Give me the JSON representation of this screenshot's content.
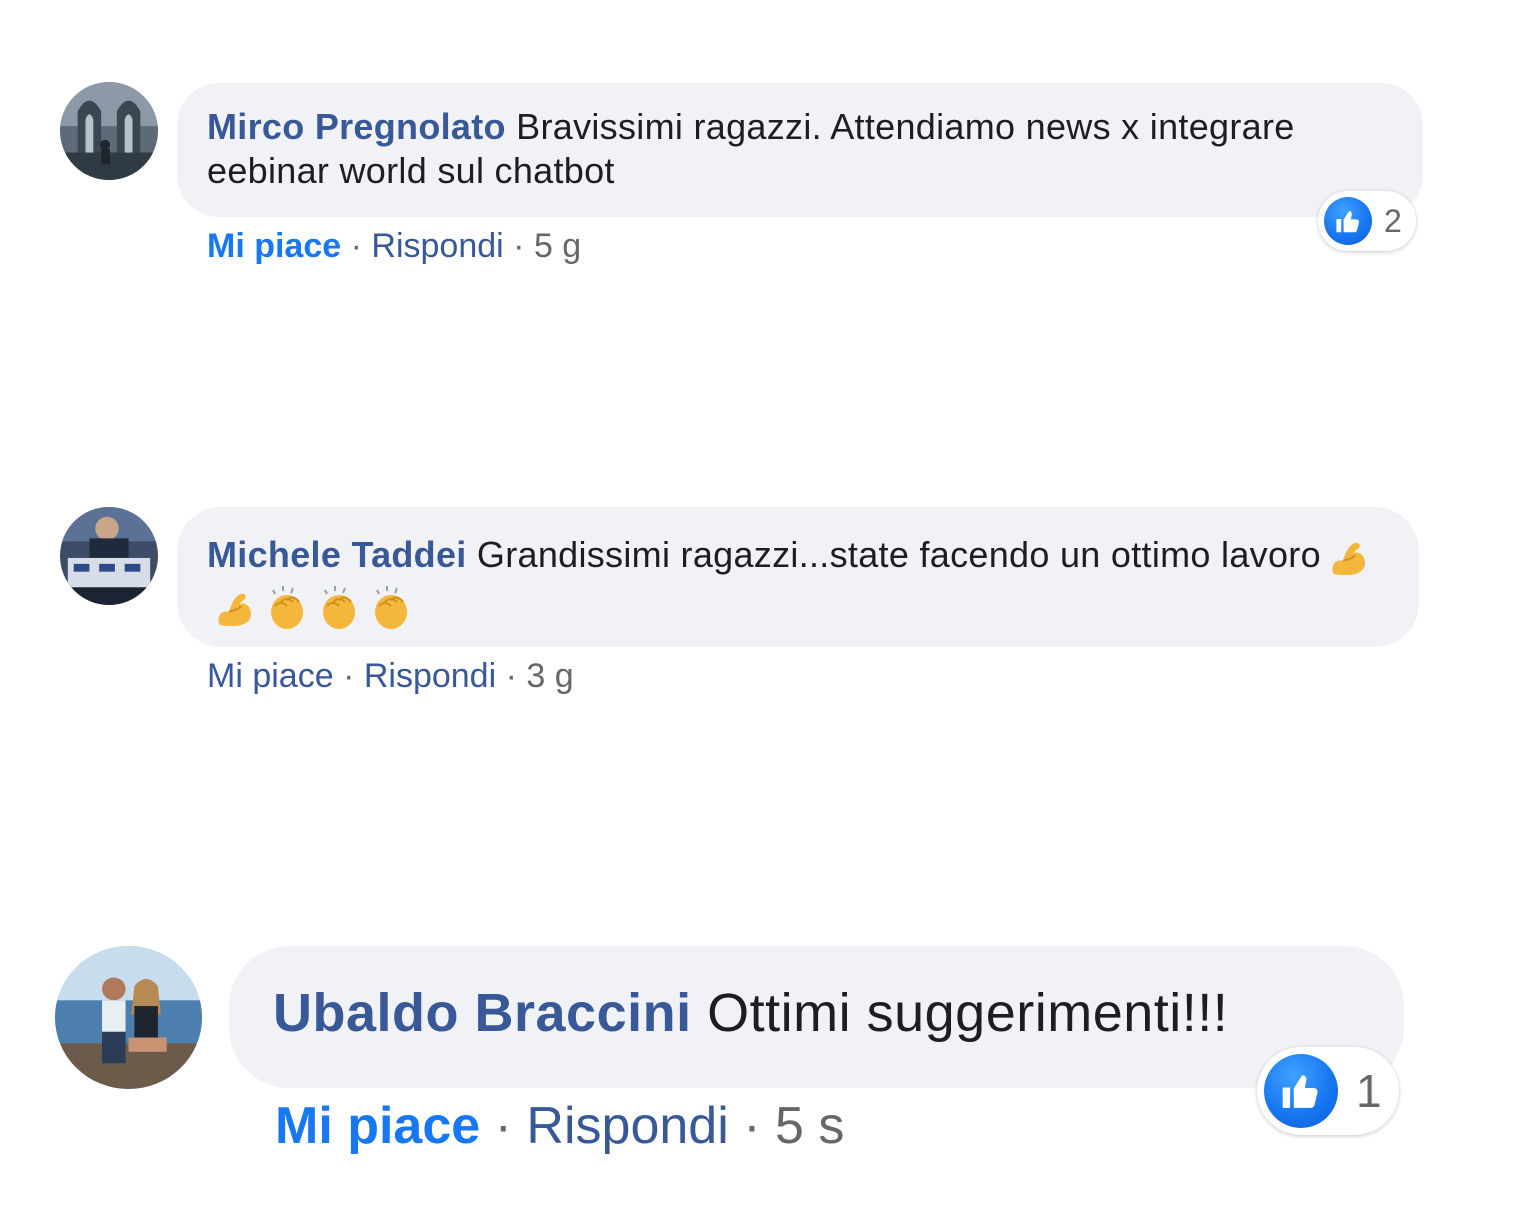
{
  "comments": [
    {
      "author": "Mirco Pregnolato",
      "text": "Bravissimi ragazzi. Attendiamo news x integrare eebinar world sul chatbot",
      "like_label": "Mi piace",
      "like_active": true,
      "reply_label": "Rispondi",
      "separator": "·",
      "time": "5 g",
      "reaction_count": "2",
      "reaction_icon": "like-icon",
      "avatar_icon": "avatar"
    },
    {
      "author": "Michele Taddei",
      "text": "Grandissimi ragazzi...state facendo un ottimo lavoro",
      "emojis": [
        "flexed-biceps-emoji",
        "flexed-biceps-emoji",
        "clapping-hands-emoji",
        "clapping-hands-emoji",
        "clapping-hands-emoji"
      ],
      "like_label": "Mi piace",
      "like_active": false,
      "reply_label": "Rispondi",
      "separator": "·",
      "time": "3 g",
      "avatar_icon": "avatar"
    },
    {
      "author": "Ubaldo Braccini",
      "text": "Ottimi suggerimenti!!!",
      "like_label": "Mi piace",
      "like_active": true,
      "reply_label": "Rispondi",
      "separator": "·",
      "time": "5 s",
      "reaction_count": "1",
      "reaction_icon": "like-icon",
      "avatar_icon": "avatar"
    }
  ],
  "colors": {
    "author": "#385898",
    "like_active": "#1877f2",
    "link": "#385898",
    "meta": "#65676b",
    "bubble": "#f0f2f5",
    "text": "#1c1e21"
  }
}
